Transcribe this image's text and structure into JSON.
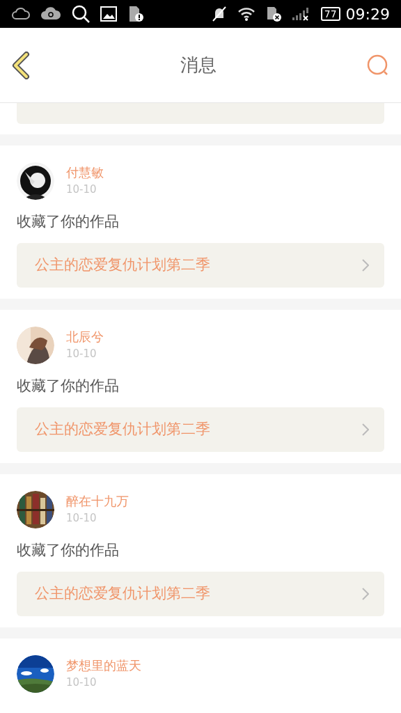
{
  "status_bar": {
    "battery": "77",
    "time": "09:29"
  },
  "header": {
    "title": "消息"
  },
  "messages": [
    {
      "name": "付慧敏",
      "date": "10-10",
      "action": "收藏了你的作品",
      "work": "公主的恋爱复仇计划第二季"
    },
    {
      "name": "北辰兮",
      "date": "10-10",
      "action": "收藏了你的作品",
      "work": "公主的恋爱复仇计划第二季"
    },
    {
      "name": "醉在十九万",
      "date": "10-10",
      "action": "收藏了你的作品",
      "work": "公主的恋爱复仇计划第二季"
    },
    {
      "name": "梦想里的蓝天",
      "date": "10-10"
    }
  ]
}
